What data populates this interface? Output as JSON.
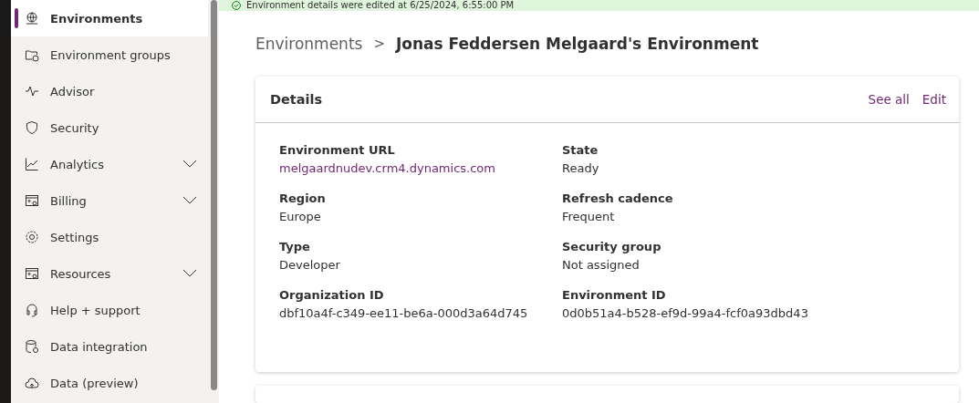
{
  "sidebar": {
    "items": [
      {
        "label": "Environments",
        "selected": true,
        "expandable": false
      },
      {
        "label": "Environment groups",
        "selected": false,
        "expandable": false
      },
      {
        "label": "Advisor",
        "selected": false,
        "expandable": false
      },
      {
        "label": "Security",
        "selected": false,
        "expandable": false
      },
      {
        "label": "Analytics",
        "selected": false,
        "expandable": true
      },
      {
        "label": "Billing",
        "selected": false,
        "expandable": true
      },
      {
        "label": "Settings",
        "selected": false,
        "expandable": false
      },
      {
        "label": "Resources",
        "selected": false,
        "expandable": true
      },
      {
        "label": "Help + support",
        "selected": false,
        "expandable": false
      },
      {
        "label": "Data integration",
        "selected": false,
        "expandable": false
      },
      {
        "label": "Data (preview)",
        "selected": false,
        "expandable": false
      }
    ]
  },
  "banner": {
    "message": "Environment details were edited at 6/25/2024, 6:55:00 PM"
  },
  "breadcrumb": {
    "parent": "Environments",
    "separator": ">",
    "current": "Jonas Feddersen Melgaard's Environment"
  },
  "details": {
    "title": "Details",
    "actions": [
      "See all",
      "Edit"
    ],
    "fields": [
      {
        "label": "Environment URL",
        "value": "melgaardnudev.crm4.dynamics.com",
        "kind": "link"
      },
      {
        "label": "State",
        "value": "Ready",
        "kind": "text"
      },
      {
        "label": "Region",
        "value": "Europe",
        "kind": "text"
      },
      {
        "label": "Refresh cadence",
        "value": "Frequent",
        "kind": "text"
      },
      {
        "label": "Type",
        "value": "Developer",
        "kind": "text"
      },
      {
        "label": "Security group",
        "value": "Not assigned",
        "kind": "text"
      },
      {
        "label": "Organization ID",
        "value": "dbf10a4f-c349-ee11-be6a-000d3a64d745",
        "kind": "text"
      },
      {
        "label": "Environment ID",
        "value": "0d0b51a4-b528-ef9d-99a4-fcf0a93dbd43",
        "kind": "text"
      }
    ]
  }
}
